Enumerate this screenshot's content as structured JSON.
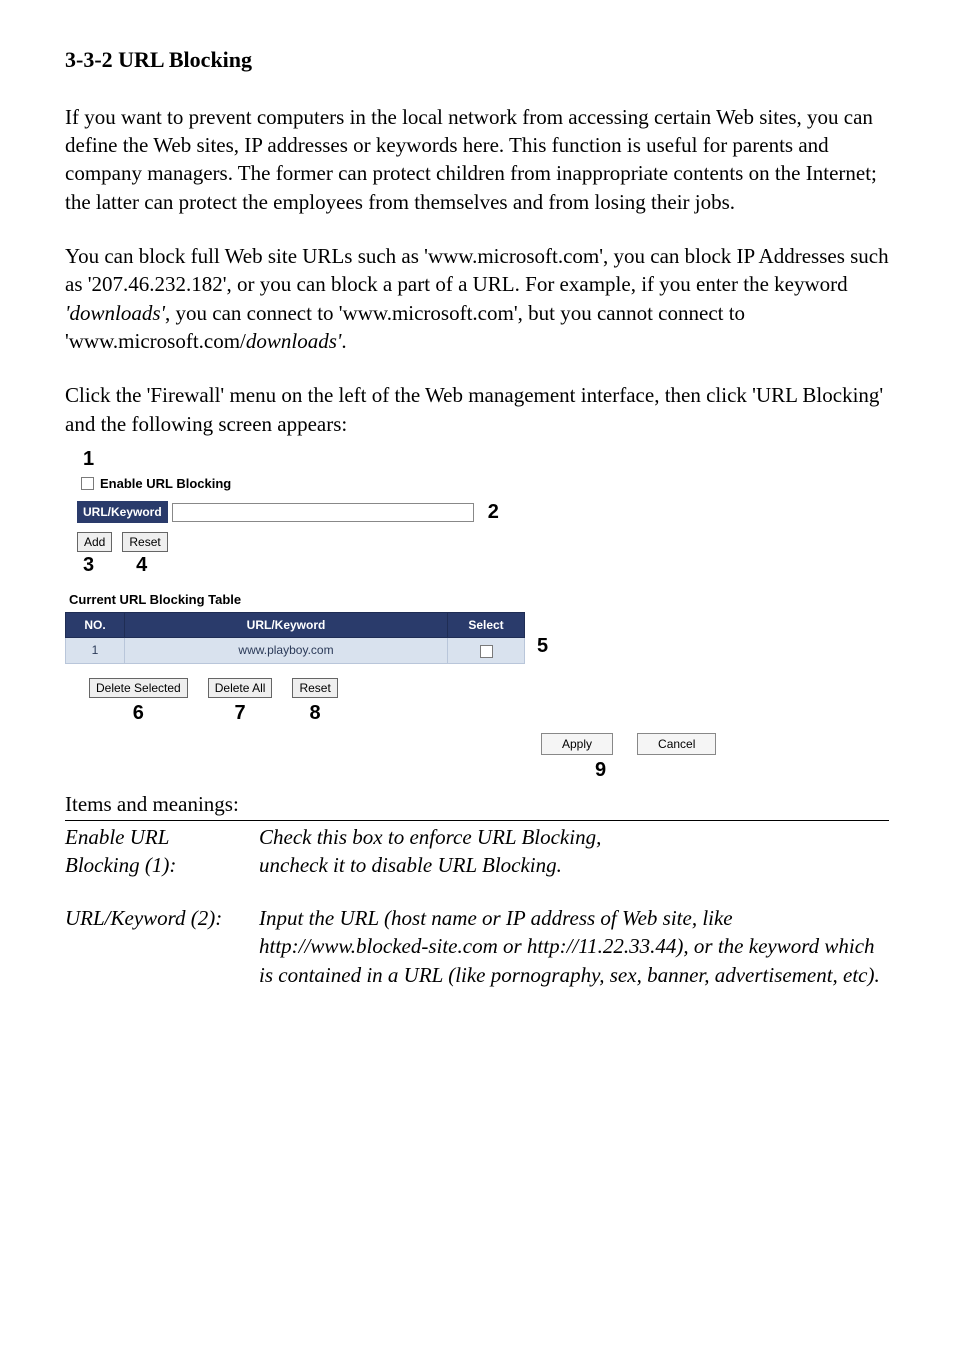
{
  "heading": "3-3-2 URL Blocking",
  "para1": "If you want to prevent computers in the local network from accessing certain Web sites, you can define the Web sites, IP addresses or keywords here. This function is useful for parents and company managers. The former can protect children from inappropriate contents on the Internet; the latter can protect the employees from themselves and from losing their jobs.",
  "para2_a": "You can block full Web site URLs such as 'www.microsoft.com', you can block IP Addresses such as '207.46.232.182', or you can block a part of a URL. For example, if you enter the keyword ",
  "para2_b": "'downloads'",
  "para2_c": ", you can connect to 'www.microsoft.com', but you cannot connect to 'www.microsoft.com/",
  "para2_d": "downloads'",
  "para2_e": ".",
  "para3": "Click the 'Firewall' menu on the left of the Web management interface, then click 'URL Blocking' and the following screen appears:",
  "markers": {
    "m1": "1",
    "m2": "2",
    "m3": "3",
    "m4": "4",
    "m5": "5",
    "m6": "6",
    "m7": "7",
    "m8": "8",
    "m9": "9"
  },
  "ui": {
    "enable_label": "Enable URL Blocking",
    "url_keyword_label": "URL/Keyword",
    "add_btn": "Add",
    "reset_btn": "Reset",
    "table_title": "Current URL Blocking Table",
    "col_no": "NO.",
    "col_kw": "URL/Keyword",
    "col_sel": "Select",
    "row1_no": "1",
    "row1_kw": "www.playboy.com",
    "del_sel": "Delete Selected",
    "del_all": "Delete All",
    "reset2": "Reset",
    "apply": "Apply",
    "cancel": "Cancel"
  },
  "items_heading": "Items and meanings:",
  "defs": {
    "t1a": "Enable URL",
    "t1b": "Blocking (1):",
    "d1a": "Check this box to enforce URL Blocking,",
    "d1b": "uncheck it to disable URL Blocking.",
    "t2": "URL/Keyword (2):",
    "d2": "Input the URL (host name or IP address of Web site, like http://www.blocked-site.com or http://11.22.33.44), or the keyword which is contained in a URL (like pornography, sex, banner, advertisement, etc)."
  }
}
